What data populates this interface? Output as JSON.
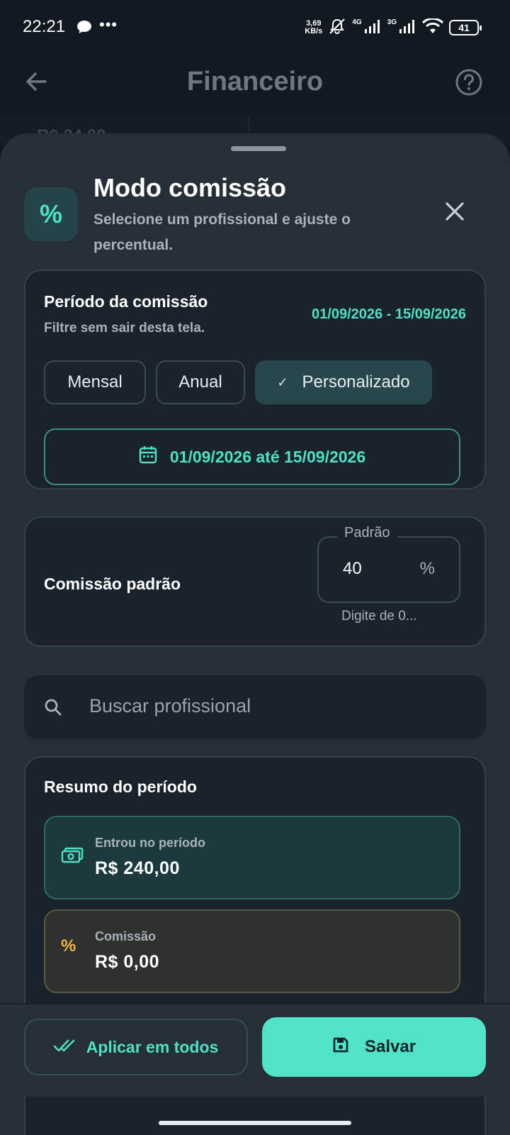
{
  "status_bar": {
    "time": "22:21",
    "speed": "3,69",
    "speed_unit": "KB/s",
    "net1": "4G",
    "net2": "3G",
    "battery": "41"
  },
  "app_bar": {
    "title": "Financeiro",
    "peek_value": "R$ 24,00"
  },
  "sheet": {
    "title": "Modo comissão",
    "subtitle": "Selecione um profissional e ajuste o percentual.",
    "icon": "%"
  },
  "period": {
    "title": "Período da comissão",
    "subtitle": "Filtre sem sair desta tela.",
    "range": "01/09/2026 - 15/09/2026",
    "chips": [
      "Mensal",
      "Anual",
      "Personalizado"
    ],
    "selected": "Personalizado",
    "date_button": "01/09/2026 até 15/09/2026"
  },
  "default_commission": {
    "label": "Comissão padrão",
    "field_label": "Padrão",
    "value": "40",
    "unit": "%",
    "helper": "Digite de 0..."
  },
  "search": {
    "placeholder": "Buscar profissional"
  },
  "summary": {
    "title": "Resumo do período",
    "items": [
      {
        "label": "Entrou no período",
        "value": "R$  240,00"
      },
      {
        "label": "Comissão",
        "value": "R$  0,00"
      }
    ]
  },
  "actions": {
    "apply_all": "Aplicar em todos",
    "save": "Salvar"
  },
  "colors": {
    "accent": "#4fe0c3",
    "commission": "#f2b64a",
    "sheet_bg": "#262f38",
    "card_bg": "#1a222b"
  }
}
